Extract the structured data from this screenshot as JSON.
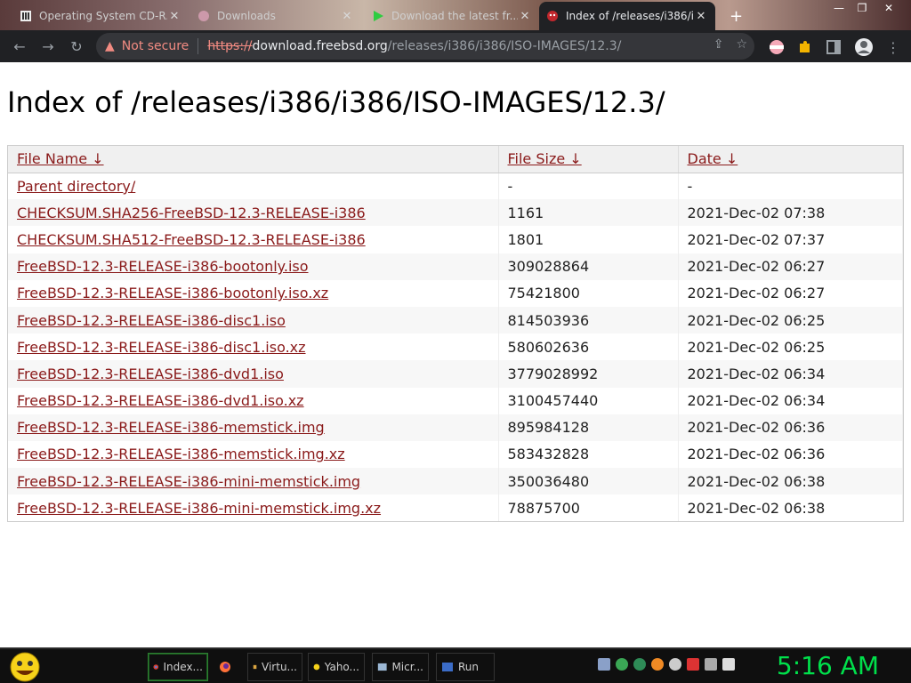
{
  "browser": {
    "tabs": [
      {
        "label": "Operating System CD-R...",
        "active": false
      },
      {
        "label": "Downloads",
        "active": false
      },
      {
        "label": "Download the latest fr...",
        "active": false
      },
      {
        "label": "Index of /releases/i386/i3",
        "active": true
      }
    ],
    "new_tab": "+",
    "address": {
      "security": "Not secure",
      "scheme": "https://",
      "host": "download.freebsd.org",
      "path": "/releases/i386/i386/ISO-IMAGES/12.3/"
    }
  },
  "page": {
    "title": "Index of /releases/i386/i386/ISO-IMAGES/12.3/",
    "columns": {
      "name": "File Name  ↓",
      "size": "File Size  ↓",
      "date": "Date  ↓"
    },
    "rows": [
      {
        "name": "Parent directory/",
        "size": "-",
        "date": "-"
      },
      {
        "name": "CHECKSUM.SHA256-FreeBSD-12.3-RELEASE-i386",
        "size": "1161",
        "date": "2021-Dec-02 07:38"
      },
      {
        "name": "CHECKSUM.SHA512-FreeBSD-12.3-RELEASE-i386",
        "size": "1801",
        "date": "2021-Dec-02 07:37"
      },
      {
        "name": "FreeBSD-12.3-RELEASE-i386-bootonly.iso",
        "size": "309028864",
        "date": "2021-Dec-02 06:27"
      },
      {
        "name": "FreeBSD-12.3-RELEASE-i386-bootonly.iso.xz",
        "size": "75421800",
        "date": "2021-Dec-02 06:27"
      },
      {
        "name": "FreeBSD-12.3-RELEASE-i386-disc1.iso",
        "size": "814503936",
        "date": "2021-Dec-02 06:25"
      },
      {
        "name": "FreeBSD-12.3-RELEASE-i386-disc1.iso.xz",
        "size": "580602636",
        "date": "2021-Dec-02 06:25"
      },
      {
        "name": "FreeBSD-12.3-RELEASE-i386-dvd1.iso",
        "size": "3779028992",
        "date": "2021-Dec-02 06:34"
      },
      {
        "name": "FreeBSD-12.3-RELEASE-i386-dvd1.iso.xz",
        "size": "3100457440",
        "date": "2021-Dec-02 06:34"
      },
      {
        "name": "FreeBSD-12.3-RELEASE-i386-memstick.img",
        "size": "895984128",
        "date": "2021-Dec-02 06:36"
      },
      {
        "name": "FreeBSD-12.3-RELEASE-i386-memstick.img.xz",
        "size": "583432828",
        "date": "2021-Dec-02 06:36"
      },
      {
        "name": "FreeBSD-12.3-RELEASE-i386-mini-memstick.img",
        "size": "350036480",
        "date": "2021-Dec-02 06:38"
      },
      {
        "name": "FreeBSD-12.3-RELEASE-i386-mini-memstick.img.xz",
        "size": "78875700",
        "date": "2021-Dec-02 06:38"
      }
    ]
  },
  "taskbar": {
    "tasks": [
      {
        "label": "Index...",
        "active": true
      },
      {
        "label": "",
        "active": false
      },
      {
        "label": "Virtu...",
        "active": false
      },
      {
        "label": "Yaho...",
        "active": false
      },
      {
        "label": "Micr...",
        "active": false
      },
      {
        "label": "Run",
        "active": false
      }
    ],
    "clock": "5:16 AM"
  },
  "colors": {
    "link": "#8a1a1a",
    "clock": "#00e04b",
    "toolbar": "#202124"
  }
}
